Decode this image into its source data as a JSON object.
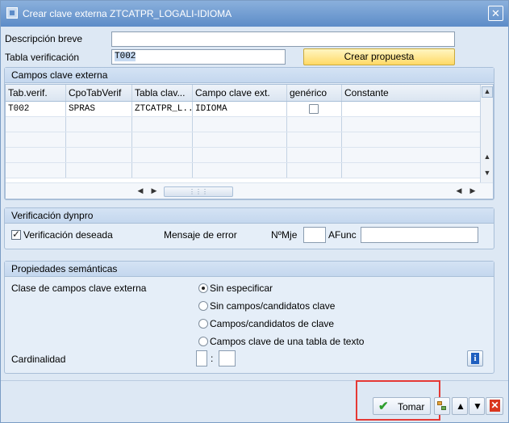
{
  "window": {
    "title": "Crear clave externa ZTCATPR_LOGALI-IDIOMA",
    "close_glyph": "✕"
  },
  "header": {
    "descripcion_label": "Descripción breve",
    "descripcion_value": "",
    "tabla_label": "Tabla verificación",
    "tabla_value": "T002",
    "crear_propuesta_label": "Crear propuesta"
  },
  "campos_group": {
    "title": "Campos clave externa",
    "columns": [
      "Tab.verif.",
      "CpoTabVerif",
      "Tabla clav...",
      "Campo clave ext.",
      "genérico",
      "Constante"
    ],
    "rows": [
      {
        "tab": "T002",
        "cpo": "SPRAS",
        "tabla": "ZTCATPR_L...",
        "campo": "IDIOMA",
        "generico": false,
        "constante": ""
      }
    ]
  },
  "dynpro_group": {
    "title": "Verificación dynpro",
    "verificacion_label": "Verificación deseada",
    "verificacion_checked": true,
    "mensaje_label": "Mensaje de error",
    "nomje_label": "NºMje",
    "nomje_value": "",
    "afunc_label": "AFunc",
    "afunc_value": ""
  },
  "semanticas_group": {
    "title": "Propiedades semánticas",
    "clase_label": "Clase de campos clave externa",
    "options": [
      "Sin especificar",
      "Sin campos/candidatos clave",
      "Campos/candidatos de clave",
      "Campos clave de una tabla de texto"
    ],
    "selected_option": 0,
    "cardinalidad_label": "Cardinalidad",
    "card_left": "",
    "card_sep": ":",
    "card_right": "",
    "info_glyph": "i"
  },
  "footer": {
    "tomar_label": "Tomar"
  },
  "colors": {
    "highlight_frame": "#e53935",
    "accept_green": "#2e9e2e",
    "cancel_red": "#d9361e"
  }
}
